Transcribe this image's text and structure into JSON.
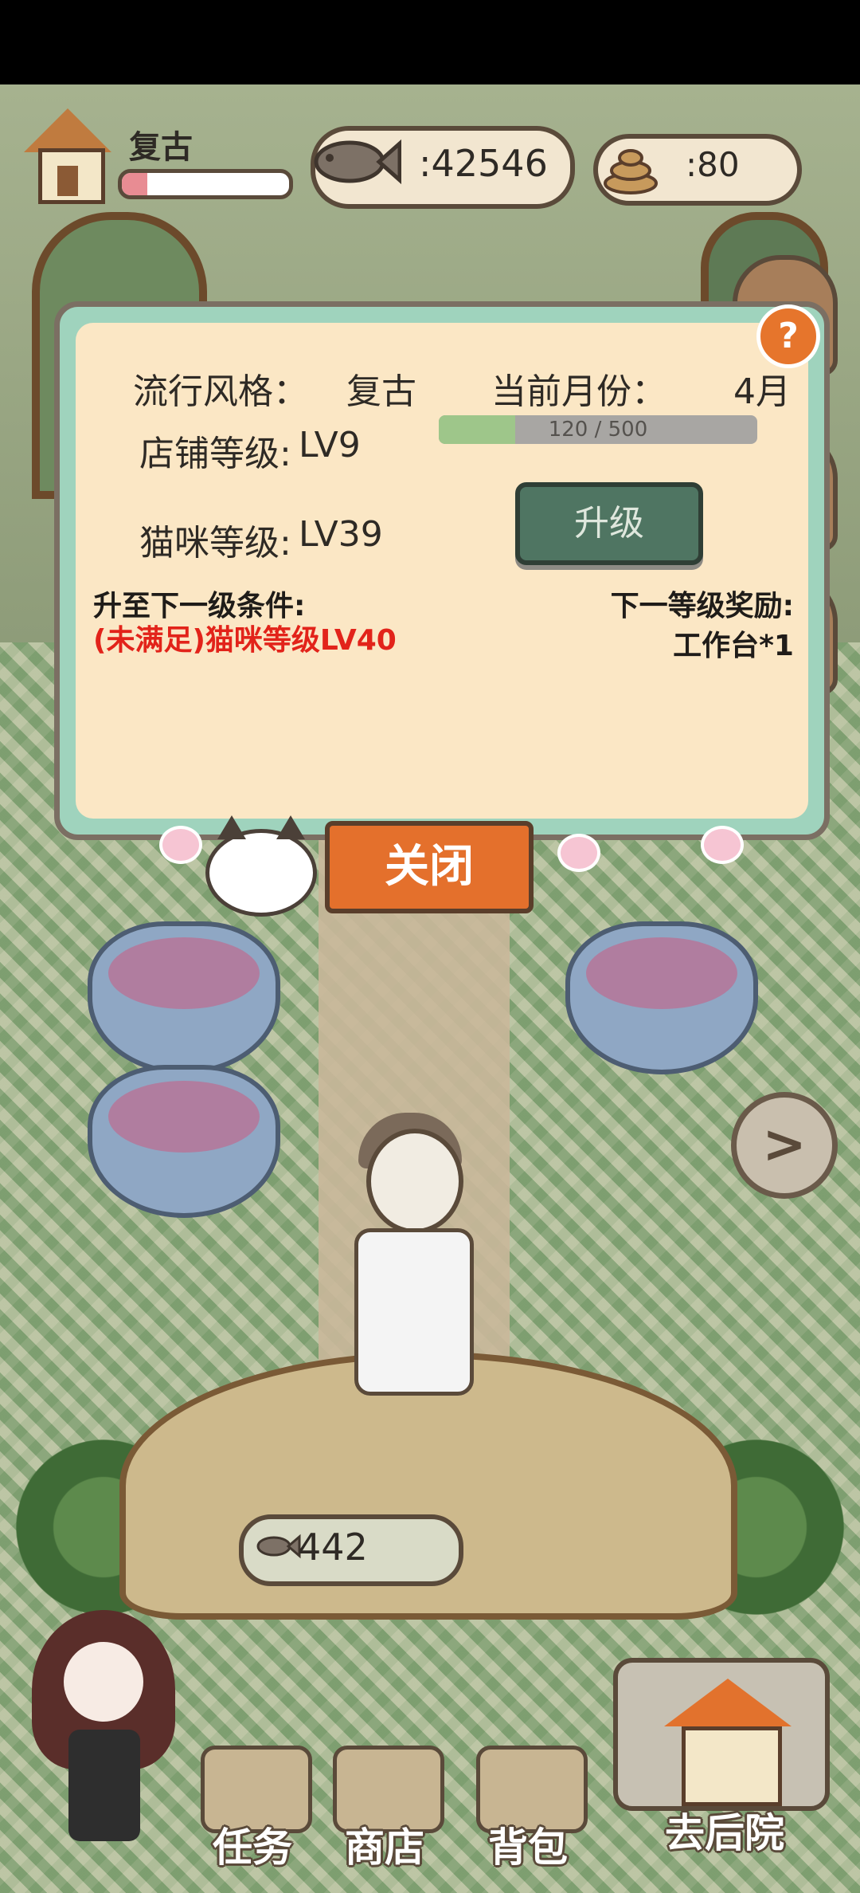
{
  "header": {
    "style_name": "复古",
    "style_progress": 0.15,
    "fish_count": ":42546",
    "poop_count": ":80"
  },
  "panel": {
    "style_label": "流行风格：",
    "style_value": "复古",
    "month_label": "当前月份：",
    "month_value": "4月",
    "shop_level_label": "店铺等级:",
    "shop_level_value": "LV9",
    "shop_progress_text": "120 / 500",
    "shop_progress": 0.24,
    "cat_level_label": "猫咪等级:",
    "cat_level_value": "LV39",
    "upgrade_label": "升级",
    "condition_title": "升至下一级条件:",
    "condition_text": "(未满足)猫咪等级LV40",
    "reward_title": "下一等级奖励:",
    "reward_text": "工作台*1",
    "help_label": "?",
    "close_label": "关闭"
  },
  "scene": {
    "price_value": "442",
    "arrow_label": ">"
  },
  "nav": {
    "task_label": "任务",
    "shop_label": "商店",
    "bag_label": "背包",
    "backyard_label": "去后院"
  },
  "colors": {
    "panel_border": "#9fd3bd",
    "panel_bg": "#fbe7c5",
    "upgrade_button": "#4f7562",
    "close_button": "#e4702c",
    "condition_text": "#e2231a",
    "help_button": "#e6752c"
  }
}
